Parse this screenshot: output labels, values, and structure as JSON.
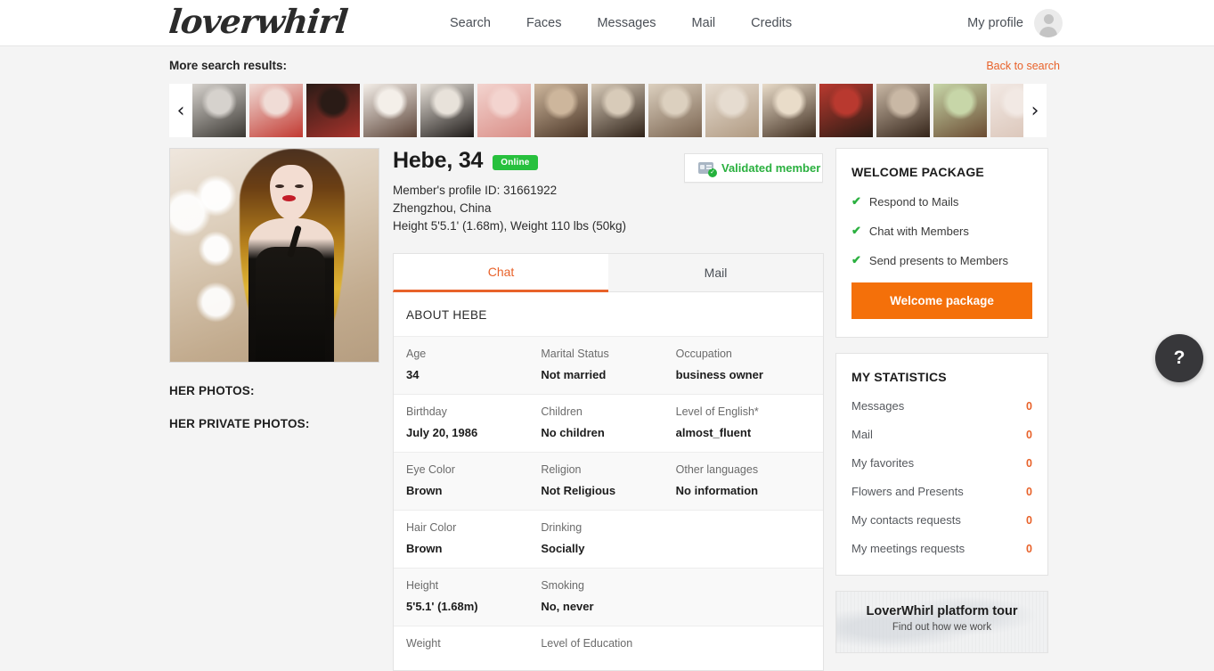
{
  "header": {
    "logo_text": "loverwhirl",
    "nav": [
      {
        "label": "Search"
      },
      {
        "label": "Faces"
      },
      {
        "label": "Messages"
      },
      {
        "label": "Mail"
      },
      {
        "label": "Credits"
      }
    ],
    "profile_label": "My profile"
  },
  "results_bar": {
    "title": "More search results:",
    "back_link": "Back to search",
    "prev_arrow": "‹",
    "next_arrow": "›",
    "thumbnails": [
      {
        "alt": "thumb-1",
        "c1": "#d6d2cd",
        "c2": "#3a3732"
      },
      {
        "alt": "thumb-2",
        "c1": "#f0dcd6",
        "c2": "#c23a32"
      },
      {
        "alt": "thumb-3",
        "c1": "#2a1b16",
        "c2": "#a8332c"
      },
      {
        "alt": "thumb-4",
        "c1": "#f4efe9",
        "c2": "#5a4236"
      },
      {
        "alt": "thumb-5",
        "c1": "#e8e2da",
        "c2": "#1e1a18"
      },
      {
        "alt": "thumb-6",
        "c1": "#f3d4cf",
        "c2": "#d98d86"
      },
      {
        "alt": "thumb-7",
        "c1": "#cdb69c",
        "c2": "#4a3526"
      },
      {
        "alt": "thumb-8",
        "c1": "#d8cbb9",
        "c2": "#2f2218"
      },
      {
        "alt": "thumb-9",
        "c1": "#dcd0bf",
        "c2": "#7a6450"
      },
      {
        "alt": "thumb-10",
        "c1": "#e6dcd0",
        "c2": "#b09a82"
      },
      {
        "alt": "thumb-11",
        "c1": "#e9dcc9",
        "c2": "#3f2d1f"
      },
      {
        "alt": "thumb-12",
        "c1": "#b9392f",
        "c2": "#2b1c14"
      },
      {
        "alt": "thumb-13",
        "c1": "#c9b8a5",
        "c2": "#35251a"
      },
      {
        "alt": "thumb-14",
        "c1": "#c7d6a8",
        "c2": "#6a4b32"
      },
      {
        "alt": "thumb-15",
        "c1": "#f2e9e4",
        "c2": "#d9c3b6"
      }
    ]
  },
  "left": {
    "photos_label": "HER PHOTOS:",
    "private_photos_label": "HER PRIVATE PHOTOS:"
  },
  "profile": {
    "name": "Hebe, 34",
    "online_badge": "Online",
    "member_id_line": "Member's profile ID: 31661922",
    "location": "Zhengzhou, China",
    "measurements": "Height 5'5.1' (1.68m), Weight 110 lbs (50kg)",
    "validated_label": "Validated member"
  },
  "tabs": [
    {
      "label": "Chat",
      "active": true
    },
    {
      "label": "Mail",
      "active": false
    }
  ],
  "about": {
    "title": "ABOUT HEBE",
    "rows": [
      [
        {
          "key": "Age",
          "value": "34"
        },
        {
          "key": "Marital Status",
          "value": "Not married"
        },
        {
          "key": "Occupation",
          "value": "business owner"
        }
      ],
      [
        {
          "key": "Birthday",
          "value": "July 20, 1986"
        },
        {
          "key": "Children",
          "value": "No children"
        },
        {
          "key": "Level of English*",
          "value": "almost_fluent"
        }
      ],
      [
        {
          "key": "Eye Color",
          "value": "Brown"
        },
        {
          "key": "Religion",
          "value": "Not Religious"
        },
        {
          "key": "Other languages",
          "value": "No information"
        }
      ],
      [
        {
          "key": "Hair Color",
          "value": "Brown"
        },
        {
          "key": "Drinking",
          "value": "Socially"
        },
        {
          "key": "",
          "value": ""
        }
      ],
      [
        {
          "key": "Height",
          "value": "5'5.1' (1.68m)"
        },
        {
          "key": "Smoking",
          "value": "No, never"
        },
        {
          "key": "",
          "value": ""
        }
      ],
      [
        {
          "key": "Weight",
          "value": ""
        },
        {
          "key": "Level of Education",
          "value": ""
        },
        {
          "key": "",
          "value": ""
        }
      ]
    ]
  },
  "welcome_package": {
    "title": "WELCOME PACKAGE",
    "check_glyph": "✔",
    "perks": [
      "Respond to Mails",
      "Chat with Members",
      "Send presents to Members"
    ],
    "button_label": "Welcome package"
  },
  "statistics": {
    "title": "MY STATISTICS",
    "rows": [
      {
        "label": "Messages",
        "value": "0"
      },
      {
        "label": "Mail",
        "value": "0"
      },
      {
        "label": "My favorites",
        "value": "0"
      },
      {
        "label": "Flowers and Presents",
        "value": "0"
      },
      {
        "label": "My contacts requests",
        "value": "0"
      },
      {
        "label": "My meetings requests",
        "value": "0"
      }
    ]
  },
  "tour": {
    "title": "LoverWhirl platform tour",
    "subtitle": "Find out how we work"
  },
  "help": {
    "glyph": "?"
  },
  "colors": {
    "accent_orange": "#e8622a",
    "button_orange": "#f4700a",
    "green": "#27c03d",
    "page_bg": "#f4f4f4"
  }
}
